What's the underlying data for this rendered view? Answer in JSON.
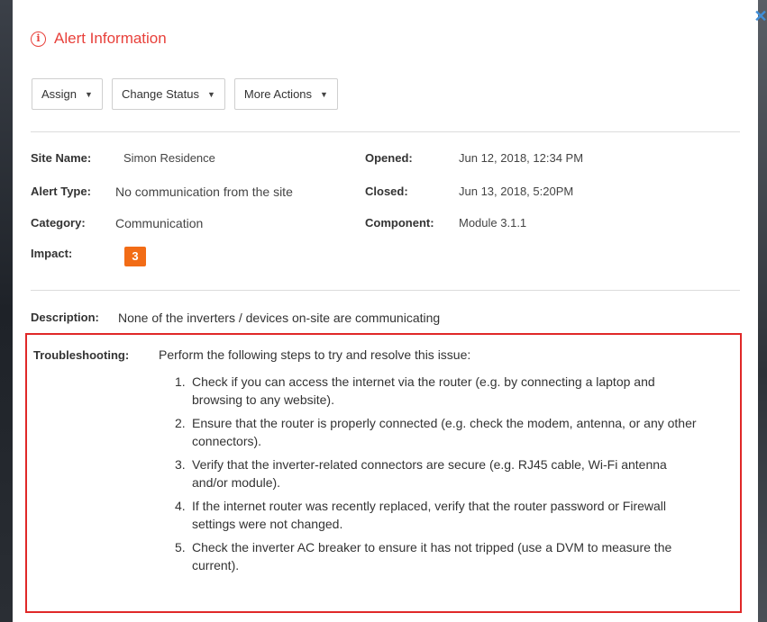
{
  "modal": {
    "title": "Alert Information",
    "close_label": "✕"
  },
  "actions": {
    "assign": "Assign",
    "change_status": "Change Status",
    "more_actions": "More Actions",
    "caret": "▼"
  },
  "fields": {
    "site_name_label": "Site Name:",
    "site_name_value": "Simon Residence",
    "alert_type_label": "Alert Type:",
    "alert_type_value": "No communication from the site",
    "category_label": "Category:",
    "category_value": "Communication",
    "impact_label": "Impact:",
    "impact_value": "3",
    "opened_label": "Opened:",
    "opened_value": "Jun 12, 2018, 12:34 PM",
    "closed_label": "Closed:",
    "closed_value": "Jun 13, 2018, 5:20PM",
    "component_label": "Component:",
    "component_value": "Module 3.1.1"
  },
  "description": {
    "label": "Description:",
    "value": "None of the inverters / devices on-site are communicating"
  },
  "troubleshooting": {
    "label": "Troubleshooting:",
    "intro": "Perform the following steps to try and resolve this issue:",
    "steps": [
      {
        "num": "1.",
        "text": "Check if you can access the internet via the router (e.g. by connecting a laptop and browsing to any website)."
      },
      {
        "num": "2.",
        "text": "Ensure that the router is properly connected (e.g. check the modem, antenna, or any other connectors)."
      },
      {
        "num": "3.",
        "text": "Verify that the inverter-related connectors are secure (e.g. RJ45 cable, Wi-Fi antenna and/or module)."
      },
      {
        "num": "4.",
        "text": "If the internet router was recently replaced, verify that the router password or Firewall settings were not changed."
      },
      {
        "num": "5.",
        "text": "Check the inverter AC breaker to ensure it has not tripped (use a DVM to measure the current)."
      }
    ]
  },
  "colors": {
    "alert_red": "#e8413b",
    "impact_orange": "#f26c16",
    "close_blue": "#3f8ed8",
    "highlight_border": "#e02828"
  }
}
